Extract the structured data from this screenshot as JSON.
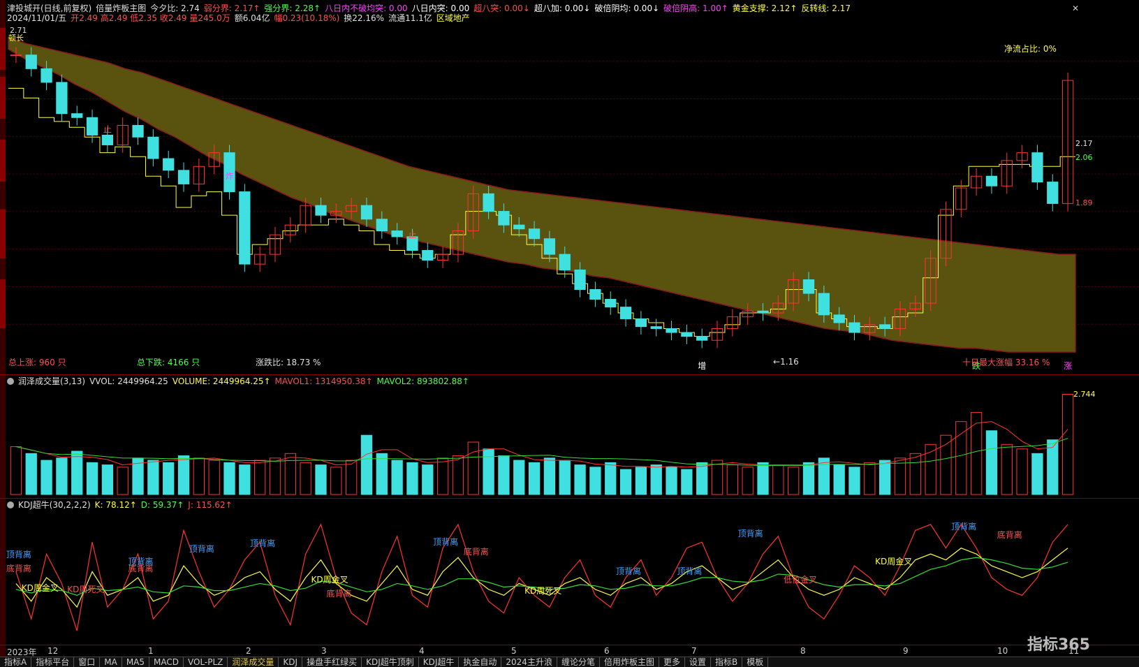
{
  "header": {
    "line1": [
      {
        "text": "津投城开(日线,前复权)",
        "color": "#e0e0e0"
      },
      {
        "text": "倍量炸板主图",
        "color": "#e0e0e0"
      },
      {
        "text": "今夕比: 2.74",
        "color": "#e0e0e0"
      },
      {
        "text": "弱分界: 2.17↑",
        "color": "#ff5050"
      },
      {
        "text": "强分界: 2.28↑",
        "color": "#50ff50"
      },
      {
        "text": "八日内不破均突: 0.00",
        "color": "#ff40ff"
      },
      {
        "text": "八日内突: 0.00",
        "color": "#ffffff"
      },
      {
        "text": "超八突: 0.00↓",
        "color": "#ff5050"
      },
      {
        "text": "超八加: 0.00↓",
        "color": "#ffffff"
      },
      {
        "text": "破倍阴均: 0.00↓",
        "color": "#ffffff"
      },
      {
        "text": "破倍阴高: 1.00↑",
        "color": "#ff40ff"
      },
      {
        "text": "黄金支撑: 2.12↑",
        "color": "#ffff40"
      },
      {
        "text": "反转线: 2.17",
        "color": "#ffff40"
      }
    ],
    "line2": [
      {
        "text": "2024/11/01/五",
        "color": "#e0e0e0"
      },
      {
        "text": "开2.49 高2.49 低2.35 收2.49 量245.0万",
        "color": "#ff5050"
      },
      {
        "text": "额6.04亿",
        "color": "#e0e0e0"
      },
      {
        "text": "幅0.23(10.18%)",
        "color": "#ff5050"
      },
      {
        "text": "换22.16%",
        "color": "#e0e0e0"
      },
      {
        "text": "流通11.1亿",
        "color": "#e0e0e0"
      },
      {
        "text": "区域地产",
        "color": "#ffff40"
      }
    ]
  },
  "main_pane": {
    "top_price": "2.71",
    "top_label": "顿长",
    "net_flow": "净流占比: 0%",
    "stats_up": "总上涨: 960 只",
    "stats_down": "总下跌: 4166 只",
    "stats_ratio": "涨跌比: 18.73 %",
    "max_gain": "十日最大涨幅 33.16 %",
    "low_price": "1.16",
    "right_levels": [
      "2.17",
      "2.06",
      "1.89"
    ],
    "markers": [
      "炸",
      "止",
      "增",
      "跌",
      "涨"
    ]
  },
  "volume_pane": {
    "title_items": [
      {
        "text": "润泽成交量(3,13)",
        "color": "#e0e0e0"
      },
      {
        "text": "VVOL: 2449964.25",
        "color": "#e0e0e0"
      },
      {
        "text": "VOLUME: 2449964.25↑",
        "color": "#ffff40"
      },
      {
        "text": "MAVOL1: 1314950.38↑",
        "color": "#ff5050"
      },
      {
        "text": "MAVOL2: 893802.88↑",
        "color": "#50ff50"
      }
    ],
    "right_value": "2.744"
  },
  "kdj_pane": {
    "title_items": [
      {
        "text": "KDJ超牛(30,2,2,2)",
        "color": "#e0e0e0"
      },
      {
        "text": "K: 78.12↑",
        "color": "#ffff40"
      },
      {
        "text": "D: 59.37↑",
        "color": "#50ff50"
      },
      {
        "text": "J: 115.62↑",
        "color": "#ff5050"
      }
    ],
    "labels": [
      "顶背离",
      "底背离",
      "KD周金叉",
      "KD周死叉",
      "低位金叉"
    ]
  },
  "date_axis": [
    "2023年",
    "12",
    "1",
    "2",
    "3",
    "4",
    "5",
    "6",
    "7",
    "8",
    "9",
    "10",
    "11"
  ],
  "bottom_tabs": [
    "指标A",
    "指标平台",
    "窗口",
    "MA",
    "MA5",
    "MACD",
    "VOL-PLZ",
    "润泽成交量",
    "KDJ",
    "操盘手红绿买",
    "KDJ超牛顶刺",
    "KDJ超牛",
    "执金自动",
    "2024主升浪",
    "缠论分笔",
    "倍用炸板主图",
    "更多",
    "设置",
    "指标B",
    "模板"
  ],
  "watermark": "指标365",
  "colors": {
    "up": "#ff3333",
    "down": "#40e0e0",
    "yellow": "#ffff40",
    "green": "#33dd33",
    "magenta": "#ff40ff",
    "cloud": "#5a5310"
  },
  "chart_data": {
    "type": "candlestick",
    "title": "津投城开(日线,前复权)",
    "price_series": [
      2.62,
      2.55,
      2.48,
      2.32,
      2.3,
      2.21,
      2.16,
      2.26,
      2.2,
      2.09,
      2.03,
      1.96,
      2.05,
      2.12,
      1.92,
      1.55,
      1.6,
      1.7,
      1.75,
      1.85,
      1.8,
      1.82,
      1.85,
      1.78,
      1.72,
      1.69,
      1.62,
      1.57,
      1.6,
      1.72,
      1.91,
      1.82,
      1.75,
      1.73,
      1.68,
      1.6,
      1.52,
      1.42,
      1.37,
      1.33,
      1.27,
      1.23,
      1.22,
      1.2,
      1.18,
      1.16,
      1.22,
      1.28,
      1.31,
      1.3,
      1.35,
      1.47,
      1.4,
      1.29,
      1.25,
      1.2,
      1.24,
      1.22,
      1.32,
      1.35,
      1.58,
      1.83,
      1.94,
      2.0,
      1.95,
      2.08,
      2.12,
      1.97,
      1.86,
      2.49
    ],
    "yellow_support": [
      2.45,
      2.4,
      2.3,
      2.28,
      2.25,
      2.2,
      2.12,
      2.15,
      2.1,
      2.0,
      1.95,
      1.84,
      1.9,
      1.92,
      1.8,
      1.6,
      1.65,
      1.68,
      1.72,
      1.75,
      1.75,
      1.78,
      1.75,
      1.72,
      1.65,
      1.62,
      1.6,
      1.58,
      1.6,
      1.7,
      1.82,
      1.82,
      1.8,
      1.7,
      1.65,
      1.58,
      1.5,
      1.45,
      1.4,
      1.35,
      1.3,
      1.27,
      1.25,
      1.22,
      1.2,
      1.18,
      1.2,
      1.24,
      1.3,
      1.3,
      1.32,
      1.42,
      1.42,
      1.3,
      1.27,
      1.23,
      1.23,
      1.22,
      1.28,
      1.3,
      1.48,
      1.8,
      1.95,
      2.05,
      2.05,
      2.06,
      2.06,
      2.05,
      2.05,
      2.1
    ],
    "cloud_top": [
      2.71,
      2.68,
      2.66,
      2.64,
      2.62,
      2.6,
      2.58,
      2.55,
      2.53,
      2.5,
      2.47,
      2.44,
      2.41,
      2.38,
      2.35,
      2.32,
      2.29,
      2.26,
      2.23,
      2.2,
      2.17,
      2.14,
      2.11,
      2.08,
      2.05,
      2.03,
      2.01,
      1.99,
      1.97,
      1.95,
      1.93,
      1.92,
      1.91,
      1.9,
      1.89,
      1.88,
      1.87,
      1.86,
      1.85,
      1.84,
      1.83,
      1.82,
      1.81,
      1.8,
      1.79,
      1.78,
      1.77,
      1.76,
      1.75,
      1.74,
      1.73,
      1.72,
      1.71,
      1.7,
      1.69,
      1.68,
      1.67,
      1.66,
      1.65,
      1.64,
      1.63,
      1.62,
      1.61,
      1.6,
      1.6
    ],
    "cloud_bottom": [
      2.65,
      2.6,
      2.56,
      2.52,
      2.47,
      2.43,
      2.38,
      2.33,
      2.29,
      2.24,
      2.2,
      2.15,
      2.1,
      2.06,
      2.01,
      1.97,
      1.93,
      1.89,
      1.86,
      1.82,
      1.79,
      1.76,
      1.73,
      1.7,
      1.68,
      1.66,
      1.64,
      1.62,
      1.6,
      1.58,
      1.56,
      1.55,
      1.53,
      1.52,
      1.51,
      1.49,
      1.48,
      1.46,
      1.44,
      1.42,
      1.4,
      1.38,
      1.36,
      1.34,
      1.32,
      1.3,
      1.28,
      1.26,
      1.24,
      1.22,
      1.21,
      1.2,
      1.18,
      1.16,
      1.15,
      1.14,
      1.13,
      1.12,
      1.12,
      1.11,
      1.1,
      1.1,
      1.1,
      1.1,
      1.1
    ],
    "volume": [
      2.1,
      1.8,
      1.5,
      1.6,
      1.9,
      1.4,
      1.3,
      1.2,
      1.6,
      1.5,
      1.4,
      1.7,
      1.6,
      1.5,
      1.4,
      1.3,
      1.5,
      1.6,
      1.8,
      1.4,
      1.3,
      1.2,
      1.5,
      2.6,
      1.8,
      1.5,
      1.4,
      1.3,
      1.6,
      1.7,
      2.3,
      2.0,
      1.7,
      1.5,
      1.4,
      1.6,
      1.5,
      1.3,
      1.2,
      1.4,
      1.1,
      1.2,
      1.3,
      1.2,
      1.1,
      1.4,
      1.5,
      1.3,
      1.2,
      1.4,
      1.3,
      1.2,
      1.4,
      1.6,
      1.3,
      1.2,
      1.4,
      1.5,
      1.6,
      1.8,
      2.2,
      2.6,
      3.2,
      3.6,
      2.8,
      2.2,
      2.0,
      1.8,
      2.4,
      4.4
    ],
    "kdj_k": [
      50,
      35,
      55,
      45,
      30,
      60,
      40,
      45,
      55,
      35,
      40,
      65,
      50,
      40,
      45,
      55,
      60,
      45,
      35,
      55,
      70,
      50,
      40,
      35,
      50,
      65,
      45,
      40,
      60,
      72,
      55,
      45,
      40,
      50,
      45,
      40,
      50,
      55,
      45,
      40,
      50,
      55,
      45,
      50,
      60,
      65,
      55,
      45,
      50,
      60,
      70,
      55,
      45,
      40,
      45,
      55,
      50,
      45,
      55,
      70,
      75,
      70,
      80,
      75,
      65,
      60,
      55,
      60,
      70,
      80
    ],
    "kdj_d": [
      45,
      42,
      45,
      44,
      40,
      46,
      44,
      45,
      47,
      43,
      42,
      48,
      47,
      44,
      44,
      47,
      50,
      48,
      44,
      46,
      52,
      51,
      47,
      43,
      45,
      50,
      48,
      45,
      48,
      54,
      54,
      51,
      47,
      48,
      47,
      45,
      46,
      49,
      48,
      45,
      46,
      49,
      48,
      48,
      51,
      55,
      55,
      52,
      51,
      53,
      58,
      57,
      53,
      49,
      47,
      49,
      49,
      48,
      50,
      56,
      62,
      65,
      70,
      72,
      70,
      67,
      63,
      62,
      64,
      68
    ],
    "kdj_j": [
      60,
      20,
      75,
      50,
      10,
      85,
      30,
      45,
      75,
      20,
      35,
      95,
      60,
      30,
      45,
      70,
      85,
      40,
      15,
      75,
      100,
      55,
      25,
      15,
      60,
      90,
      40,
      30,
      80,
      100,
      60,
      35,
      25,
      55,
      40,
      30,
      55,
      70,
      40,
      30,
      55,
      70,
      40,
      55,
      80,
      85,
      55,
      35,
      50,
      75,
      90,
      55,
      30,
      20,
      40,
      65,
      55,
      40,
      65,
      95,
      100,
      80,
      100,
      80,
      55,
      45,
      40,
      55,
      85,
      100
    ],
    "date_ticks": [
      "2023年",
      "12",
      "1",
      "2",
      "3",
      "4",
      "5",
      "6",
      "7",
      "8",
      "9",
      "10",
      "11"
    ]
  }
}
